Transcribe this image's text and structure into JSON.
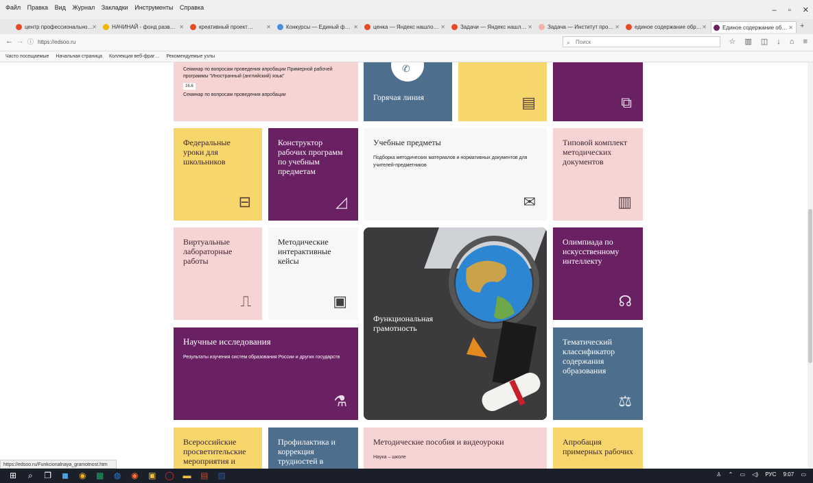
{
  "browser": {
    "menu": [
      "Файл",
      "Правка",
      "Вид",
      "Журнал",
      "Закладки",
      "Инструменты",
      "Справка"
    ],
    "tabs": [
      {
        "label": "центр профессионально…"
      },
      {
        "label": "НАЧИНАЙ - фонд разв…"
      },
      {
        "label": "креативный проект…"
      },
      {
        "label": "Конкурсы — Единый ф…"
      },
      {
        "label": "ценка — Яндекс нашло…"
      },
      {
        "label": "Задачи — Яндекс нашл…"
      },
      {
        "label": "Задача — Институт про…"
      },
      {
        "label": "единое содержание обр…"
      },
      {
        "label": "Единое содержание об…",
        "active": true
      }
    ],
    "url": "https://edsoo.ru",
    "search_placeholder": "Поиск",
    "bookmarks": [
      "Часто посещаемые",
      "Начальная страница",
      "Коллекция веб-фраг…",
      "Рекомендуемые узлы"
    ],
    "status_url": "https://edsoo.ru/Funkcionalnaya_gramotnost.htm"
  },
  "tiles": {
    "news_items": [
      {
        "text": "Семинар по вопросам проведения апробации Примерной рабочей программы \"Иностранный (английский) язык\"",
        "date": "16.6"
      },
      {
        "text": "Семинар по вопросам проведения апробации",
        "date": ""
      }
    ],
    "hotline": "Горячая линия",
    "federal_lessons": "Федеральные уроки для школьников",
    "constructor": "Конструктор рабочих программ по учебным предметам",
    "subjects_title": "Учебные предметы",
    "subjects_desc": "Подборка методических материалов и нормативных документов для учителей-предметников",
    "model_kit": "Типовой комплект методических документов",
    "virtual_labs": "Виртуальные лабораторные работы",
    "method_cases": "Методические интерактивные кейсы",
    "functional_literacy": "Функциональная грамотность",
    "olympiad_ai": "Олимпиада по искусственному интеллекту",
    "research_title": "Научные исследования",
    "research_desc": "Результаты изучения систем образования России и других государств",
    "classifier": "Тематический классификатор содержания образования",
    "all_russian": "Всероссийские просветительские мероприятия и",
    "prevention": "Профилактика и коррекция трудностей в",
    "method_manuals": "Методические пособия и видеоуроки",
    "method_manuals_desc": "Наука – школе",
    "approbation": "Апробация примерных рабочих"
  },
  "colors": {
    "pink": "#f7d4d4",
    "plum": "#6a2163",
    "yellow": "#f7d66c",
    "steel": "#4d6e8c",
    "white": "#f7f7f7"
  },
  "taskbar": {
    "lang": "РУС",
    "time": "9:07"
  }
}
